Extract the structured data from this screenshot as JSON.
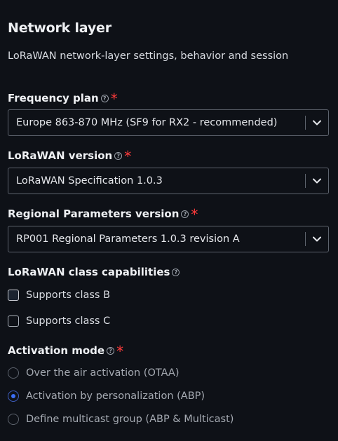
{
  "section": {
    "title": "Network layer",
    "description": "LoRaWAN network-layer settings, behavior and session"
  },
  "frequency_plan": {
    "label": "Frequency plan",
    "value": "Europe 863-870 MHz (SF9 for RX2 - recommended)"
  },
  "lorawan_version": {
    "label": "LoRaWAN version",
    "value": "LoRaWAN Specification 1.0.3"
  },
  "regional_params": {
    "label": "Regional Parameters version",
    "value": "RP001 Regional Parameters 1.0.3 revision A"
  },
  "class_caps": {
    "label": "LoRaWAN class capabilities",
    "items": [
      {
        "label": "Supports class B",
        "checked": false
      },
      {
        "label": "Supports class C",
        "checked": false
      }
    ]
  },
  "activation": {
    "label": "Activation mode",
    "options": [
      {
        "label": "Over the air activation (OTAA)",
        "selected": false
      },
      {
        "label": "Activation by personalization (ABP)",
        "selected": true
      },
      {
        "label": "Define multicast group (ABP & Multicast)",
        "selected": false
      }
    ]
  },
  "required_mark": "*",
  "help_glyph": "?",
  "colors": {
    "background": "#0e1117",
    "required": "#ff3b3b",
    "accent": "#3b6ef5"
  }
}
